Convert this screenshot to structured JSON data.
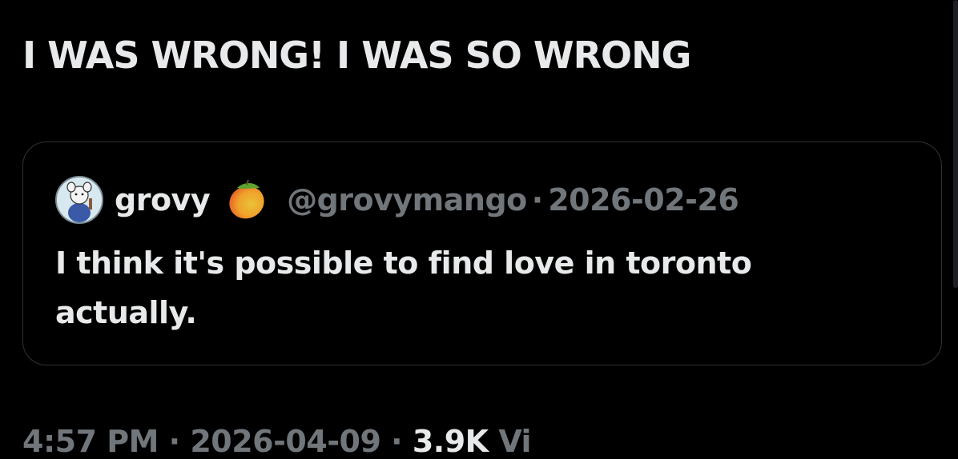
{
  "tweet": {
    "text": "I WAS WRONG! I WAS SO WRONG"
  },
  "quote": {
    "display_name": "grovy",
    "emoji_icon": "mango-icon",
    "handle": "@grovymango",
    "separator": "·",
    "date": "2026-02-26",
    "body": "I think it's possible to find love in toronto actually."
  },
  "footer": {
    "time": "4:57 PM",
    "separator": "·",
    "date": "2026-04-09",
    "separator2": "·",
    "views_count": "3.9K",
    "views_label": "Vi"
  },
  "colors": {
    "background": "#000000",
    "text_primary": "#e7e9ea",
    "text_secondary": "#71767b",
    "border": "#2f3336"
  }
}
